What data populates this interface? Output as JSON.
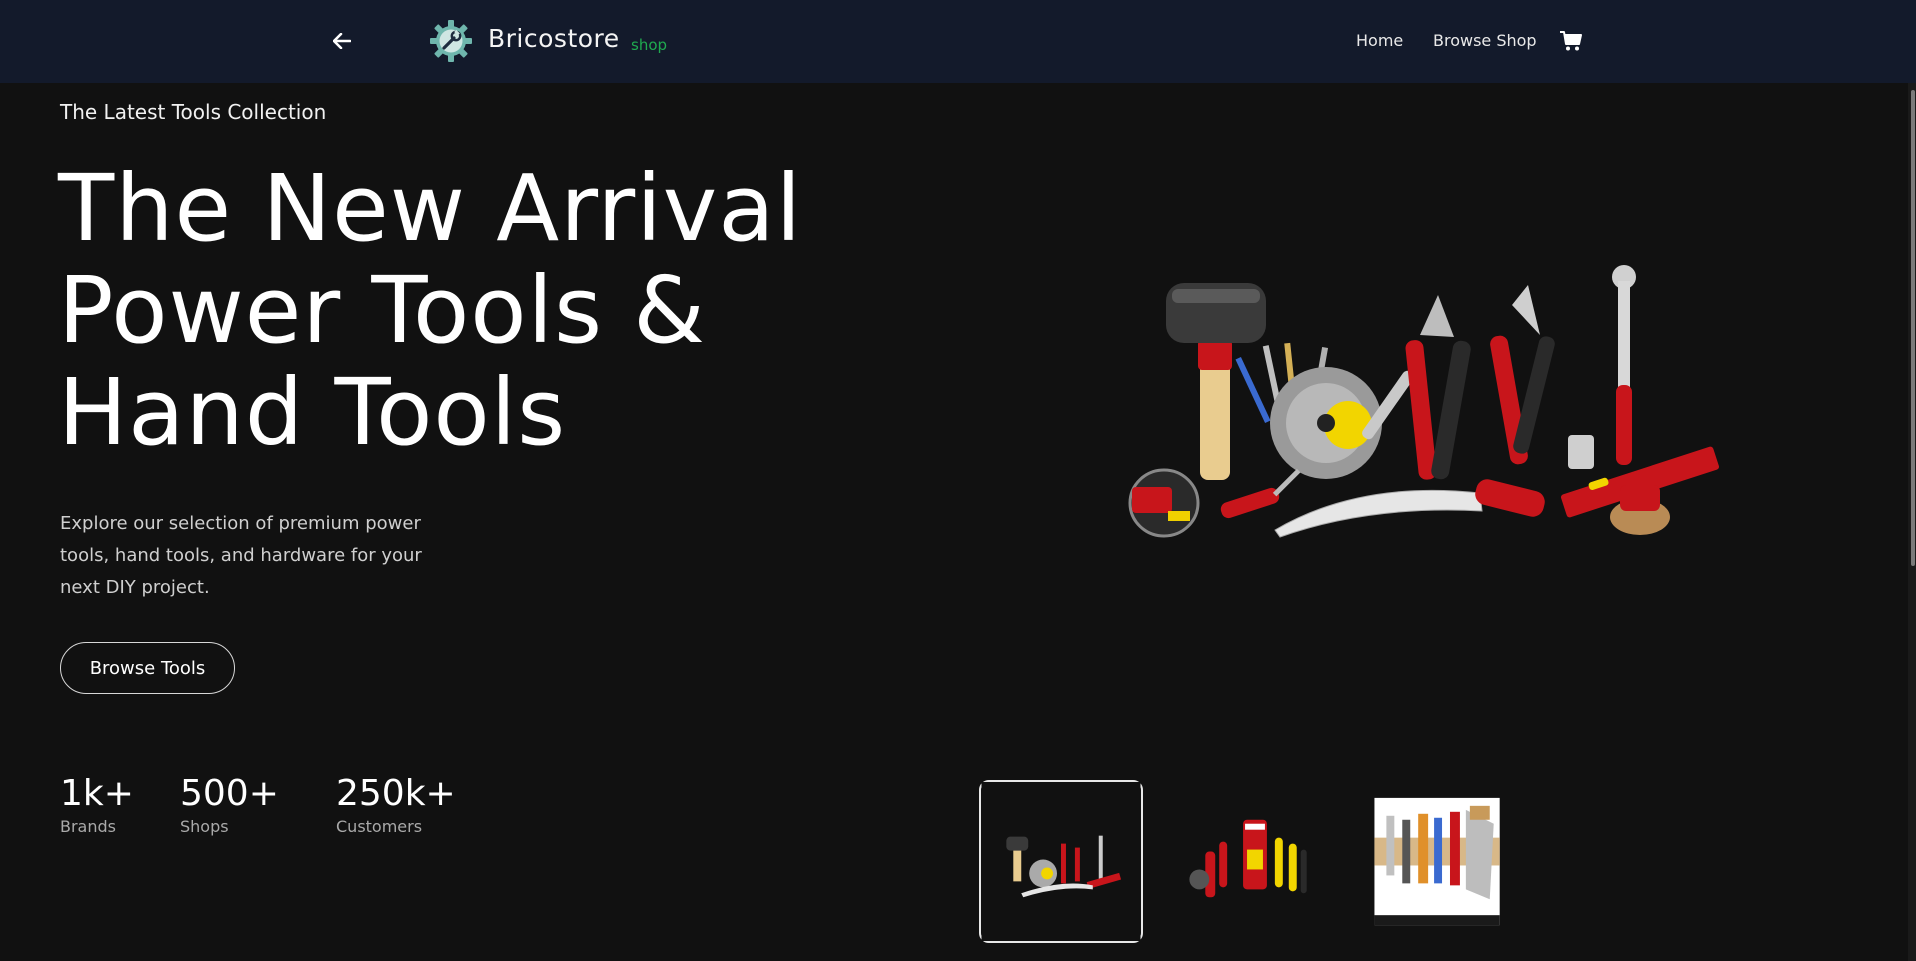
{
  "header": {
    "brand_name": "Bricostore",
    "brand_tag": "shop",
    "nav": {
      "home_label": "Home",
      "shop_label": "Browse Shop"
    },
    "icons": {
      "back": "arrow-left-icon",
      "logo": "gear-wrench-icon",
      "cart": "shopping-cart-icon"
    }
  },
  "hero": {
    "eyebrow": "The Latest Tools Collection",
    "title_lines": [
      "The New Arrival",
      "Power Tools &",
      "Hand Tools"
    ],
    "description": "Explore our selection of premium power tools, hand tools, and hardware for your next DIY project.",
    "cta_label": "Browse Tools"
  },
  "stats": [
    {
      "value": "1k+",
      "label": "Brands"
    },
    {
      "value": "500+",
      "label": "Shops"
    },
    {
      "value": "250k+",
      "label": "Customers"
    }
  ],
  "colors": {
    "nav_background": "#131a2b",
    "page_background": "#111111",
    "brand_tag": "#1faa4f",
    "tool_red": "#c8151b"
  }
}
